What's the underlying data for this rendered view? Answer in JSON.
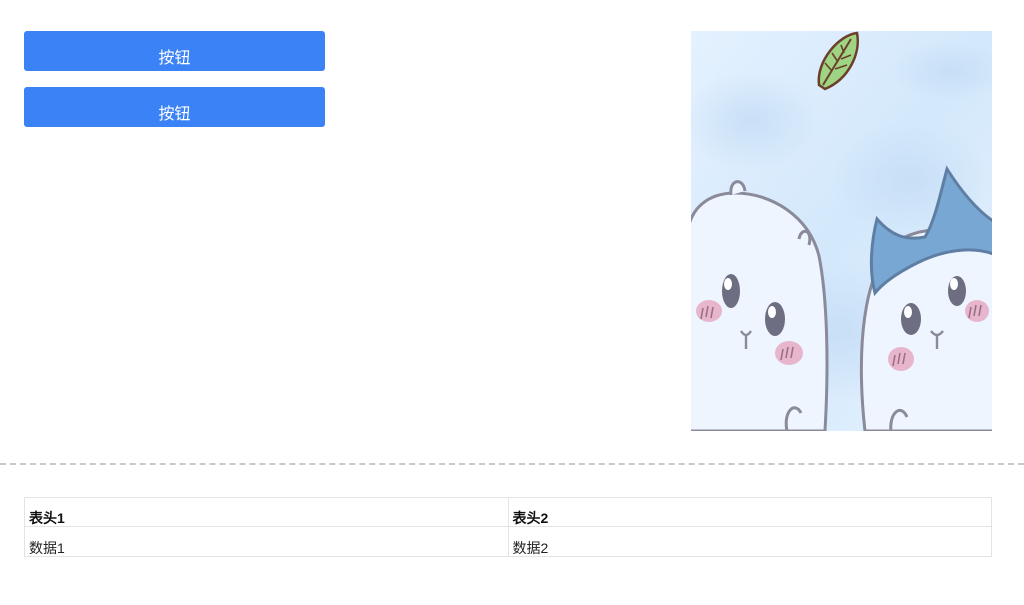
{
  "buttons": [
    {
      "label": "按钮"
    },
    {
      "label": "按钮"
    }
  ],
  "table": {
    "headers": [
      "表头1",
      "表头2"
    ],
    "rows": [
      [
        "数据1",
        "数据2"
      ]
    ]
  },
  "colors": {
    "button": "#3b82f6",
    "divider": "#c9c9c9",
    "table_border": "#e3e3e3"
  }
}
